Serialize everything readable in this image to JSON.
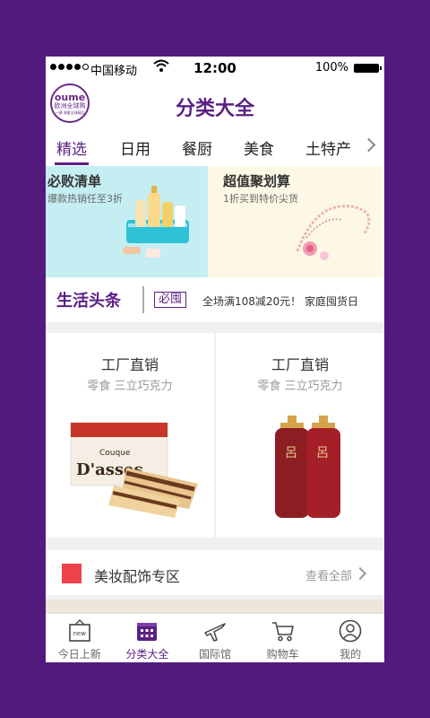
{
  "status": {
    "carrier": "中国移动",
    "time": "12:00",
    "battery": "100%"
  },
  "header": {
    "logo_line1": "oume",
    "logo_line2": "欧洲全球购",
    "logo_line3": "一键·海量全球精品",
    "title": "分类大全"
  },
  "tabs": [
    {
      "label": "精选",
      "active": true
    },
    {
      "label": "日用"
    },
    {
      "label": "餐厨"
    },
    {
      "label": "美食"
    },
    {
      "label": "土特产"
    }
  ],
  "banners": [
    {
      "title": "必败清单",
      "subtitle": "爆款热销任至3折"
    },
    {
      "title": "超值聚划算",
      "subtitle": "1折买到特价尖货"
    }
  ],
  "news": {
    "title": "生活头条",
    "badge": "必囤",
    "text": "全场满108减20元！ 家庭囤货日"
  },
  "products": [
    {
      "title": "工厂直销",
      "subtitle": "零食 三立巧克力",
      "box_brand": "Couque",
      "box_name": "D'asses"
    },
    {
      "title": "工厂直销",
      "subtitle": "零食 三立巧克力",
      "bottle_mark": "呂"
    }
  ],
  "section": {
    "title": "美妆配饰专区",
    "more": "查看全部",
    "accent": "#f0424a"
  },
  "tabbar": [
    {
      "label": "今日上新",
      "icon": "new-box-icon",
      "badge": "new"
    },
    {
      "label": "分类大全",
      "icon": "grid-store-icon",
      "active": true
    },
    {
      "label": "国际馆",
      "icon": "airplane-icon"
    },
    {
      "label": "购物车",
      "icon": "cart-icon"
    },
    {
      "label": "我的",
      "icon": "user-icon"
    }
  ],
  "colors": {
    "brand": "#5b1f84",
    "background": "#521a7c"
  }
}
